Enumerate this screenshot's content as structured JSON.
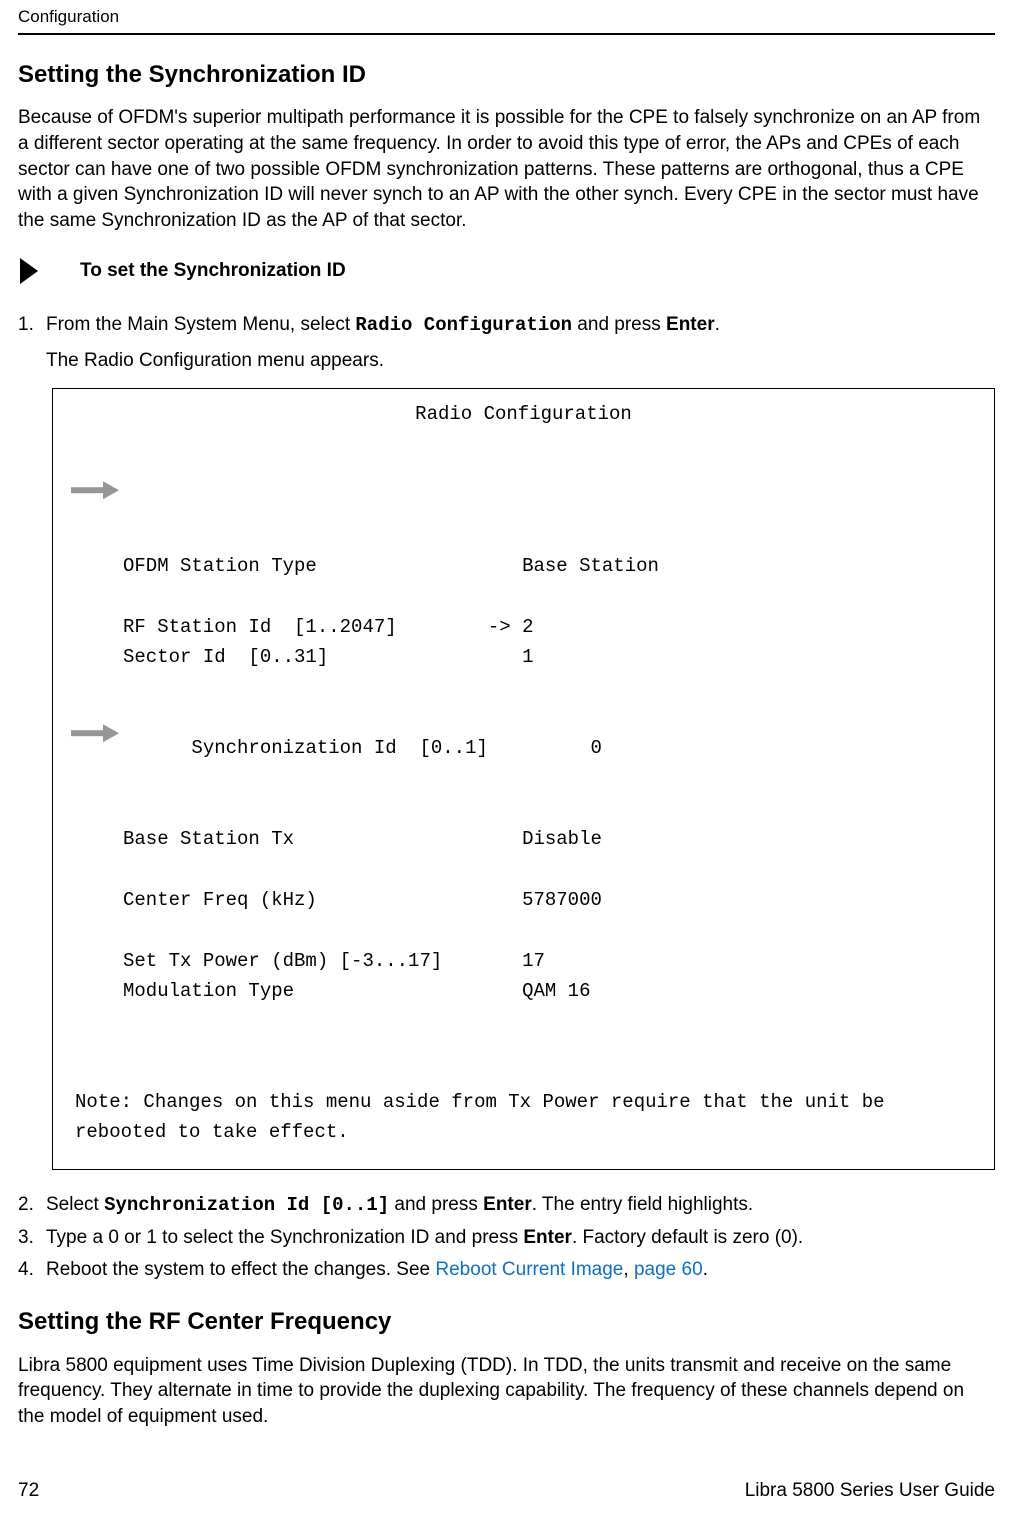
{
  "header": {
    "left": "Configuration",
    "right": ""
  },
  "section1": {
    "title": "Setting the Synchronization ID",
    "intro": "Because of OFDM's superior multipath performance it is possible for the CPE to falsely synchronize on an AP from a different sector operating at the same frequency. In order to avoid this type of error, the APs and CPEs of each sector can have one of two possible OFDM synchronization patterns. These patterns are orthogonal, thus a CPE with a given Synchronization ID will never synch to an AP with the other synch. Every CPE in the sector must have the same Synchronization ID as the AP of that sector."
  },
  "procedure": {
    "label": "To set the Synchronization ID"
  },
  "steps_pre": {
    "s1_prefix": "From the Main System Menu, select ",
    "s1_code": "Radio Configuration",
    "s1_mid": " and press ",
    "s1_bold": "Enter",
    "s1_suffix": ".",
    "s1_line2": "The Radio Configuration menu appears."
  },
  "terminal": {
    "title": "Radio Configuration",
    "line_ofdm_label": "OFDM Station Type",
    "line_ofdm_value": "Base Station",
    "line_rf_label": "RF Station Id  [1..2047]",
    "line_rf_arrow": "->",
    "line_rf_value": "2",
    "line_sector_label": "Sector Id  [0..31]",
    "line_sector_value": "1",
    "line_sync_label": "Synchronization Id  [0..1]",
    "line_sync_value": "0",
    "line_bstx_label": "Base Station Tx",
    "line_bstx_value": "Disable",
    "line_cf_label": "Center Freq (kHz)",
    "line_cf_value": "5787000",
    "line_stp_label": "Set Tx Power (dBm) [-3...17]",
    "line_stp_value": "17",
    "line_mod_label": "Modulation Type",
    "line_mod_value": "QAM 16",
    "note": "Note: Changes on this menu aside from Tx Power require that the unit be rebooted to take effect."
  },
  "steps_post": {
    "s2_prefix": "Select ",
    "s2_code": "Synchronization Id [0..1]",
    "s2_mid": " and press ",
    "s2_bold": "Enter",
    "s2_suffix": ". The entry field highlights.",
    "s3_prefix": "Type a 0 or 1 to select the Synchronization ID and press ",
    "s3_bold": "Enter",
    "s3_suffix": ". Factory default is zero (0).",
    "s4_prefix": "Reboot the system to effect the changes. See ",
    "s4_link1": "Reboot Current Image",
    "s4_sep": ", ",
    "s4_link2": "page 60",
    "s4_suffix": "."
  },
  "section2": {
    "title": "Setting the RF Center Frequency",
    "body": "Libra 5800 equipment uses Time Division Duplexing (TDD). In TDD, the units transmit and receive on the same frequency. They alternate in time to provide the duplexing capability. The frequency of these channels depend on the model of equipment used."
  },
  "footer": {
    "page_number": "72",
    "doc_title": "Libra 5800 Series User Guide"
  },
  "list_numbers": {
    "n1": "1.",
    "n2": "2.",
    "n3": "3.",
    "n4": "4."
  }
}
